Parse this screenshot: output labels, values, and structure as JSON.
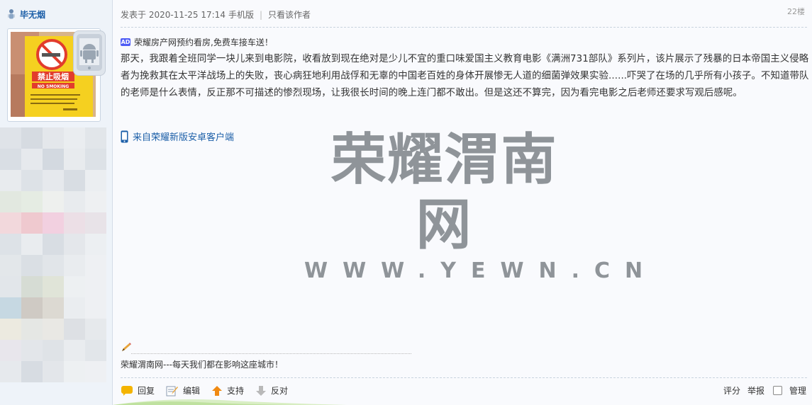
{
  "author": {
    "name": "毕无烟"
  },
  "avatar_sign": {
    "title": "禁止吸烟",
    "subtitle": "NO SMOKING"
  },
  "post": {
    "meta_prefix": "发表于 2020-11-25 17:14",
    "meta_device": "手机版",
    "meta_separator": "|",
    "only_author": "只看该作者",
    "floor": "22楼",
    "ad_badge": "AD",
    "ad_text": "荣耀房产网预约看房,免费车接车送！",
    "content": "那天，我跟着全班同学一块儿来到电影院，收看放到现在绝对是少儿不宜的重口味爱国主义教育电影《满洲731部队》系列片，该片展示了残暴的日本帝国主义侵略者为挽救其在太平洋战场上的失败，丧心病狂地利用战俘和无辜的中国老百姓的身体开展惨无人道的细菌弹效果实验......吓哭了在场的几乎所有小孩子。不知道带队的老师是什么表情，反正那不可描述的惨烈现场，让我很长时间的晚上连门都不敢出。但是这还不算完，因为看完电影之后老师还要求写观后感呢。",
    "client_link": "来自荣耀新版安卓客户端",
    "signature": "荣耀渭南网---每天我们都在影响这座城市！"
  },
  "watermark": {
    "title": "荣耀渭南网",
    "url": "WWW.YEWN.CN"
  },
  "actions": {
    "reply": "回复",
    "edit": "编辑",
    "support": "支持",
    "oppose": "反对",
    "rate": "评分",
    "report": "举报",
    "manage": "管理"
  },
  "icons": {
    "user": "user-icon",
    "android": "android-icon",
    "ad": "ad-badge-icon",
    "phone": "phone-icon",
    "pencil": "pencil-icon",
    "reply": "speech-bubble-icon",
    "edit": "edit-icon",
    "support": "arrow-up-icon",
    "oppose": "arrow-down-icon"
  },
  "colors": {
    "link": "#1c5fa8",
    "watermark": "#8f9499",
    "support_arrow": "#f08a12",
    "oppose_arrow": "#b9b9b9"
  }
}
